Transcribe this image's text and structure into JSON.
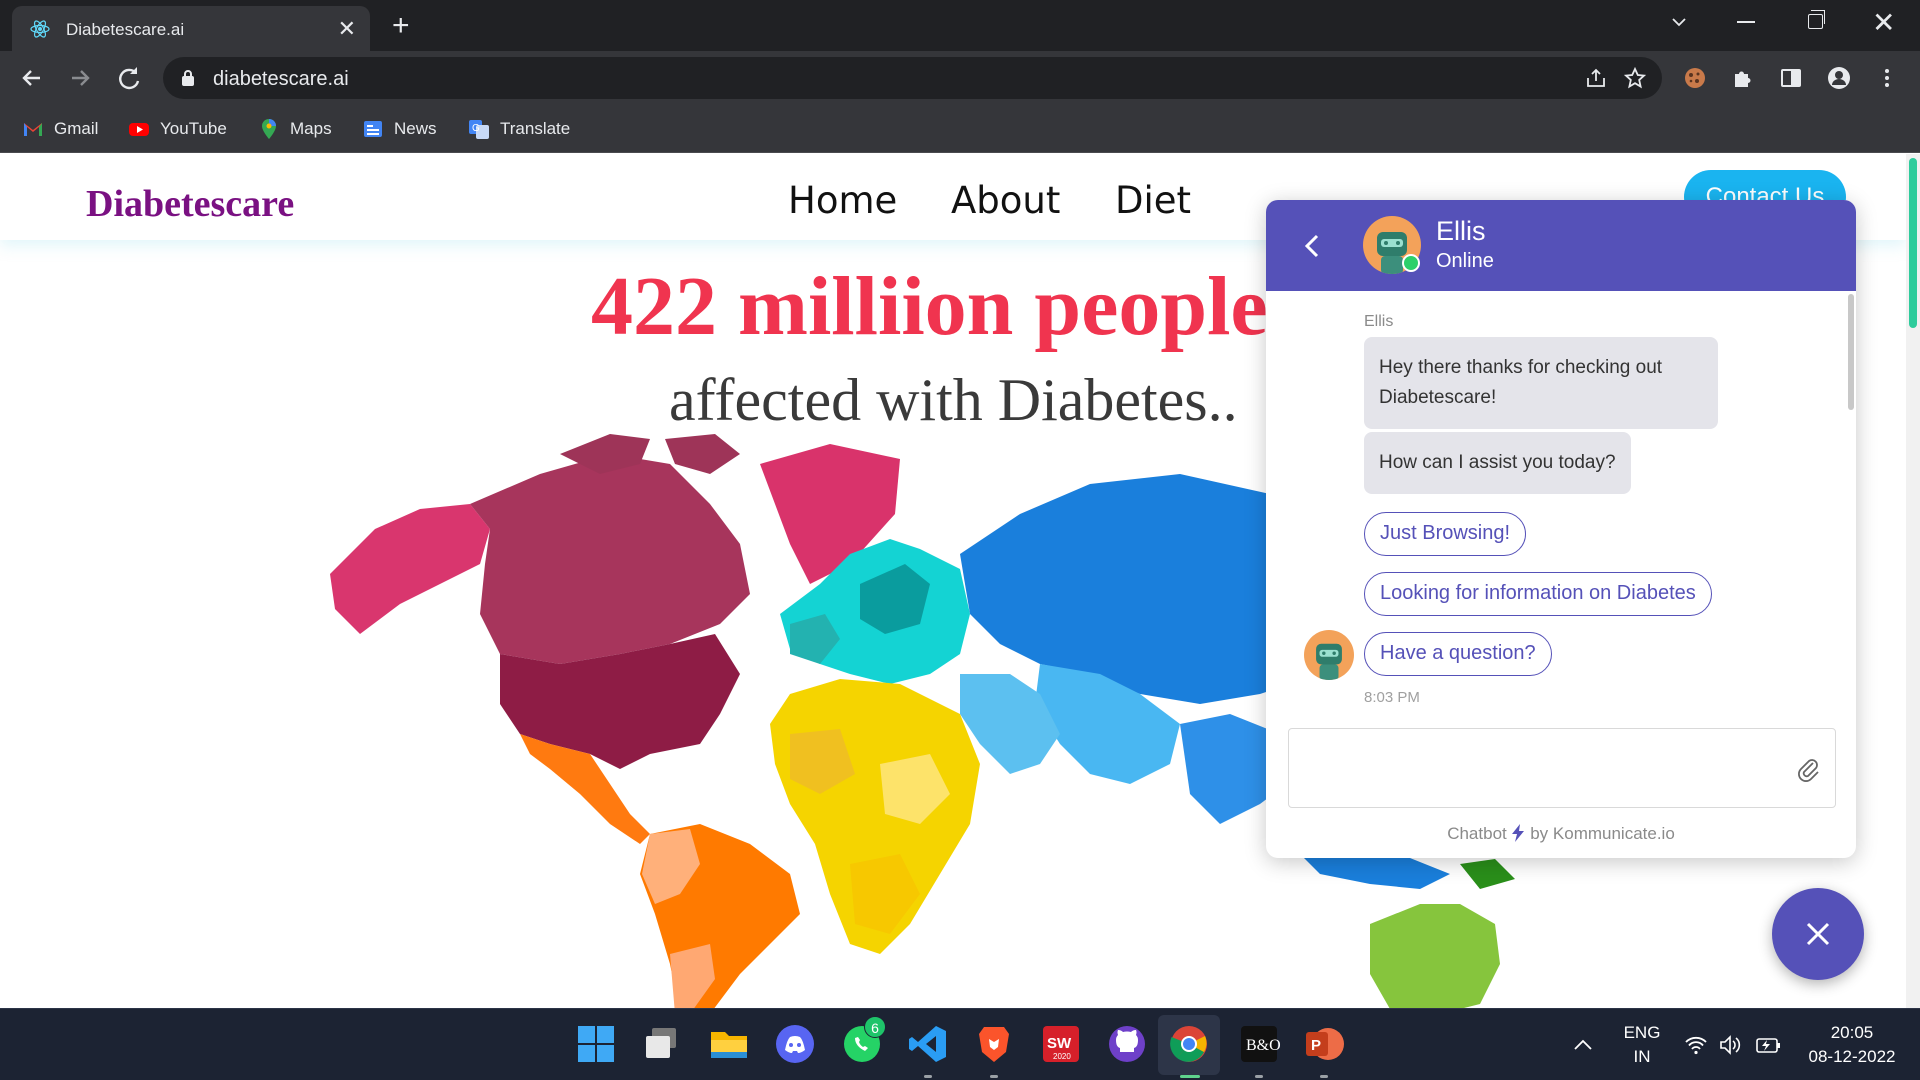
{
  "browser": {
    "tab_title": "Diabetescare.ai",
    "url": "diabetescare.ai",
    "bookmarks": [
      {
        "label": "Gmail",
        "icon": "gmail-icon"
      },
      {
        "label": "YouTube",
        "icon": "youtube-icon"
      },
      {
        "label": "Maps",
        "icon": "maps-icon"
      },
      {
        "label": "News",
        "icon": "news-icon"
      },
      {
        "label": "Translate",
        "icon": "translate-icon"
      }
    ]
  },
  "site": {
    "logo": "Diabetescare",
    "nav": [
      "Home",
      "About",
      "Diet"
    ],
    "contact_label": "Contact Us",
    "hero_title": "422 milliion people",
    "hero_subtitle": "affected with Diabetes.."
  },
  "chat": {
    "agent_name": "Ellis",
    "agent_status": "Online",
    "sender_label": "Ellis",
    "messages": [
      "Hey there thanks for checking out Diabetescare!",
      "How can I assist you today?"
    ],
    "quick_replies": [
      "Just Browsing!",
      "Looking for information on Diabetes",
      "Have a question?"
    ],
    "time": "8:03 PM",
    "input_placeholder": "",
    "powered_prefix": "Chatbot",
    "powered_suffix": "by Kommunicate.io"
  },
  "taskbar": {
    "whatsapp_badge": "6",
    "language": "ENG",
    "region": "IN",
    "time": "20:05",
    "date": "08-12-2022"
  },
  "colors": {
    "chat_accent": "#5551b8",
    "hero_red": "#f0344f",
    "logo_purple": "#7a1182",
    "contact_blue": "#1ab4f0"
  }
}
